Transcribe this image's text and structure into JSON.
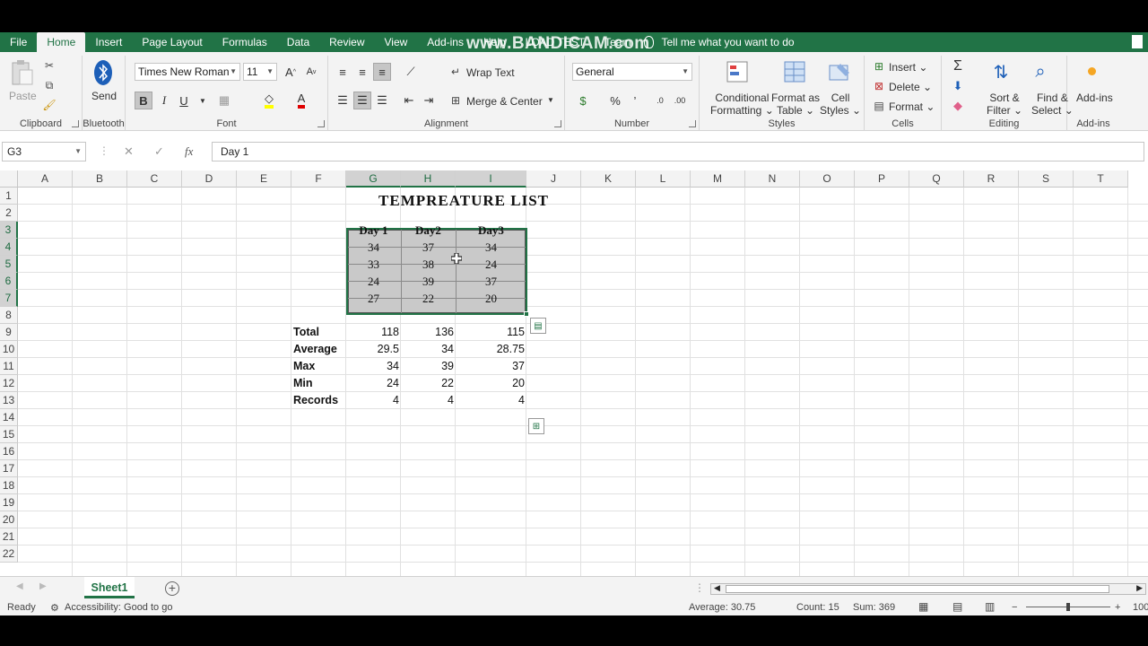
{
  "tabs": [
    "File",
    "Home",
    "Insert",
    "Page Layout",
    "Formulas",
    "Data",
    "Review",
    "View",
    "Add-ins",
    "Help",
    "LOAD TEST",
    "Team"
  ],
  "active_tab": "Home",
  "tell_me": "Tell me what you want to do",
  "watermark": "www.BANDICAM.com",
  "ribbon": {
    "clipboard": {
      "paste": "Paste",
      "label": "Clipboard"
    },
    "bluetooth": {
      "send": "Send",
      "label": "Bluetooth"
    },
    "font": {
      "name": "Times New Roman",
      "size": "11",
      "bold": "B",
      "italic": "I",
      "underline": "U",
      "label": "Font"
    },
    "alignment": {
      "wrap": "Wrap Text",
      "merge": "Merge & Center",
      "label": "Alignment"
    },
    "number": {
      "format": "General",
      "percent": "%",
      "comma": "’",
      "label": "Number"
    },
    "styles": {
      "cond1": "Conditional",
      "cond2": "Formatting",
      "fmt1": "Format as",
      "fmt2": "Table",
      "cell1": "Cell",
      "cell2": "Styles",
      "label": "Styles"
    },
    "cells": {
      "insert": "Insert",
      "delete": "Delete",
      "format": "Format",
      "label": "Cells"
    },
    "editing": {
      "sort1": "Sort &",
      "sort2": "Filter",
      "find1": "Find &",
      "find2": "Select",
      "label": "Editing"
    },
    "addins": {
      "btn": "Add-ins",
      "label": "Add-ins"
    }
  },
  "formula_bar": {
    "name_box": "G3",
    "fx": "fx",
    "content": "Day 1"
  },
  "columns": [
    "A",
    "B",
    "C",
    "D",
    "E",
    "F",
    "G",
    "H",
    "I",
    "J",
    "K",
    "L",
    "M",
    "N",
    "O",
    "P",
    "Q",
    "R",
    "S",
    "T"
  ],
  "rows": [
    "1",
    "2",
    "3",
    "4",
    "5",
    "6",
    "7",
    "8",
    "9",
    "10",
    "11",
    "12",
    "13",
    "14",
    "15",
    "16",
    "17",
    "18",
    "19",
    "20",
    "21",
    "22"
  ],
  "sheet": {
    "title": "TEMPREATURE LIST",
    "headers": [
      "Day 1",
      "Day2",
      "Day3"
    ],
    "data": [
      [
        "34",
        "37",
        "34"
      ],
      [
        "33",
        "38",
        "24"
      ],
      [
        "24",
        "39",
        "37"
      ],
      [
        "27",
        "22",
        "20"
      ]
    ],
    "stats": [
      {
        "label": "Total",
        "values": [
          "118",
          "136",
          "115"
        ]
      },
      {
        "label": "Average",
        "values": [
          "29.5",
          "34",
          "28.75"
        ]
      },
      {
        "label": "Max",
        "values": [
          "34",
          "39",
          "37"
        ]
      },
      {
        "label": "Min",
        "values": [
          "24",
          "22",
          "20"
        ]
      },
      {
        "label": "Records",
        "values": [
          "4",
          "4",
          "4"
        ]
      }
    ]
  },
  "sheet_tab": "Sheet1",
  "status": {
    "ready": "Ready",
    "accessibility": "Accessibility: Good to go",
    "average": "Average: 30.75",
    "count": "Count: 15",
    "sum": "Sum: 369",
    "zoom": "100"
  }
}
